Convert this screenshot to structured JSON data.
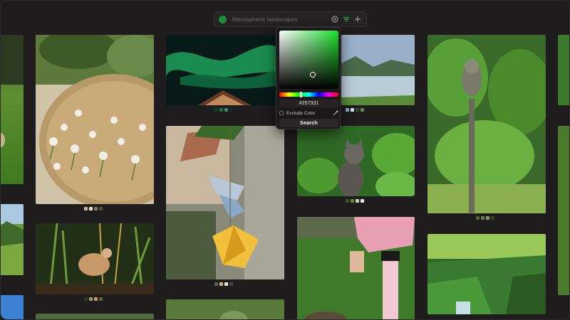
{
  "search": {
    "placeholder": "Atmospheric landscapes",
    "swatch_color": "#1f8a3a"
  },
  "picker": {
    "hex_value": "#257331",
    "exclude_label": "Exclude Color",
    "search_label": "Search",
    "exclude_checked": false
  },
  "cards": [
    {
      "name": "field-left",
      "palette": []
    },
    {
      "name": "mountain-left",
      "palette": []
    },
    {
      "name": "sky-left",
      "palette": []
    },
    {
      "name": "flower-basket",
      "palette": [
        "#c9b89a",
        "#e8e2d6",
        "#8a7a5e",
        "#4a5a3a"
      ]
    },
    {
      "name": "chicken-grass",
      "palette": [
        "#2d3a1f",
        "#8fa05a",
        "#c49a6c",
        "#5a6b2e"
      ]
    },
    {
      "name": "aurora",
      "palette": [
        "#0f3d2a",
        "#1b6b45",
        "#3a8a6a",
        "#1a2a2a"
      ]
    },
    {
      "name": "origami-cranes",
      "palette": [
        "#5a6a4a",
        "#c9b97a",
        "#e8e8e8",
        "#3a4a3a"
      ]
    },
    {
      "name": "moss-bottom",
      "palette": []
    },
    {
      "name": "mountain-lake",
      "palette": [
        "#8fa8c8",
        "#d8e4ec",
        "#2f4a3a",
        "#6a8a4a"
      ]
    },
    {
      "name": "kitten",
      "palette": [
        "#2f5a2a",
        "#6a8a3a",
        "#c8d8b0",
        "#e8e8e8"
      ]
    },
    {
      "name": "soccer",
      "palette": []
    },
    {
      "name": "owl-forest",
      "palette": [
        "#4a6a2a",
        "#6a7a5a",
        "#8a9a6a",
        "#2f4a1f"
      ]
    },
    {
      "name": "waterfall-forest",
      "palette": []
    },
    {
      "name": "right-edge",
      "palette": []
    }
  ]
}
